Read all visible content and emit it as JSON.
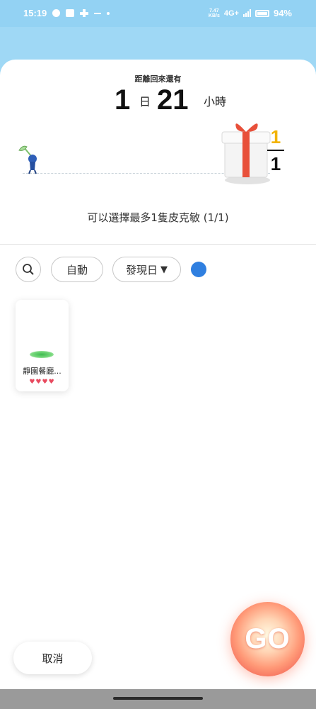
{
  "status_bar": {
    "time": "15:19",
    "network_speed_value": "7.47",
    "network_speed_unit": "KB/s",
    "network_type": "4G+",
    "battery_percent": "94%"
  },
  "countdown": {
    "label": "距離回來還有",
    "days": "1",
    "days_unit": "日",
    "hours": "21",
    "hours_unit": "小時"
  },
  "gift": {
    "numerator": "1",
    "denominator": "1"
  },
  "selection": {
    "hint": "可以選擇最多1隻皮克敏 (1/1)"
  },
  "filters": {
    "search_icon": "search-icon",
    "auto_label": "自動",
    "sort_label": "發現日",
    "sort_arrow": "▼",
    "color_dot": "#2f7fe0"
  },
  "pikmin_cards": [
    {
      "name": "靜園餐廳...",
      "hearts": "♥♥♥♥"
    }
  ],
  "actions": {
    "cancel_label": "取消",
    "go_label": "GO"
  },
  "colors": {
    "sky": "#93d2f3",
    "accent_orange": "#f46a5a",
    "gift_yellow": "#f2b300"
  }
}
